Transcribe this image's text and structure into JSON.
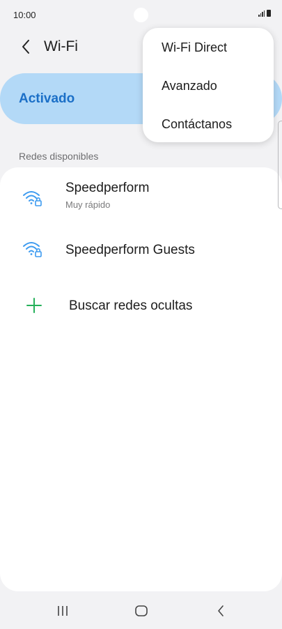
{
  "status_bar": {
    "time": "10:00",
    "icons": [
      "camera-cutout",
      "signal-icon",
      "battery-icon"
    ]
  },
  "header": {
    "back_icon": "chevron-left-icon",
    "title": "Wi-Fi"
  },
  "master_switch": {
    "label": "Activado",
    "state": "on"
  },
  "networks": {
    "section_label": "Redes disponibles",
    "items": [
      {
        "name": "Speedperform",
        "subtitle": "Muy rápido",
        "icon": "wifi-locked-icon"
      },
      {
        "name": "Speedperform Guests",
        "subtitle": "",
        "icon": "wifi-locked-icon"
      }
    ],
    "add_hidden": {
      "label": "Buscar redes ocultas",
      "icon": "plus-icon"
    }
  },
  "overflow_menu": {
    "items": [
      {
        "label": "Wi-Fi Direct"
      },
      {
        "label": "Avanzado"
      },
      {
        "label": "Contáctanos"
      }
    ]
  },
  "nav_bar": {
    "buttons": [
      "recent-apps-icon",
      "home-icon",
      "back-icon"
    ]
  },
  "colors": {
    "accent": "#1b6fc7",
    "switch_background": "#b3d9f7",
    "wifi_icon": "#3d9bf0",
    "add_icon": "#25b05a",
    "background": "#f2f2f4"
  }
}
